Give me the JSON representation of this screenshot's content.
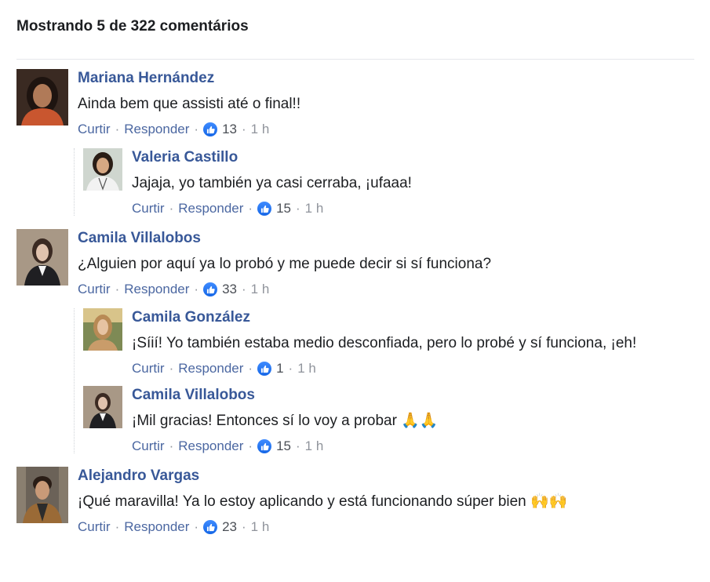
{
  "header": {
    "title": "Mostrando 5 de 322 comentários"
  },
  "labels": {
    "like": "Curtir",
    "reply": "Responder",
    "dot": "·"
  },
  "colors": {
    "name": "#385898",
    "link": "#4b67a1",
    "like_badge": "#1877f2",
    "muted": "#90949c"
  },
  "comments": [
    {
      "name": "Mariana Hernández",
      "text": "Ainda bem que assisti até o final!!",
      "likes": "13",
      "time": "1 h",
      "avatar": "woman-orange-shirt",
      "replies": [
        {
          "name": "Valeria Castillo",
          "text": "Jajaja, yo también ya casi cerraba, ¡ufaaa!",
          "likes": "15",
          "time": "1 h",
          "avatar": "woman-nurse"
        }
      ]
    },
    {
      "name": "Camila Villalobos",
      "text": "¿Alguien por aquí ya lo probó y me puede decir si sí funciona?",
      "likes": "33",
      "time": "1 h",
      "avatar": "woman-blazer",
      "replies": [
        {
          "name": "Camila González",
          "text": "¡Síií! Yo también estaba medio desconfiada, pero lo probé y sí funciona, ¡eh!",
          "likes": "1",
          "time": "1 h",
          "avatar": "woman-field"
        },
        {
          "name": "Camila Villalobos",
          "text": "¡Mil gracias! Entonces sí lo voy a probar",
          "emoji": "🙏🙏",
          "likes": "15",
          "time": "1 h",
          "avatar": "woman-blazer"
        }
      ]
    },
    {
      "name": "Alejandro Vargas",
      "text": "¡Qué maravilla! Ya lo estoy aplicando y está funcionando súper bien",
      "emoji": "🙌🙌",
      "likes": "23",
      "time": "1 h",
      "avatar": "man-jacket"
    }
  ]
}
